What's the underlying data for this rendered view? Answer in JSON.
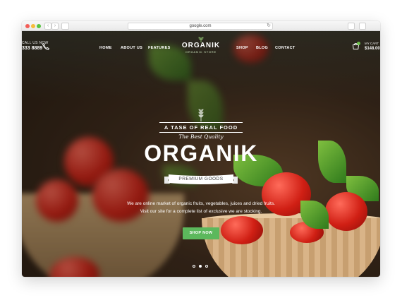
{
  "browser": {
    "url": "google.com",
    "back_glyph": "‹",
    "forward_glyph": "›",
    "reload_glyph": "↻"
  },
  "header": {
    "call_label": "CALL US NOW",
    "call_number": "333 8889",
    "nav_left": [
      "HOME",
      "ABOUT US",
      "FEATURES"
    ],
    "nav_right": [
      "SHOP",
      "BLOG",
      "CONTACT"
    ],
    "logo_title": "ORGANIK",
    "logo_subtitle": "ORGANIC STORE",
    "cart_label": "MY CART",
    "cart_total": "$148.00"
  },
  "hero": {
    "tagline": "A TASE OF REAL FOOD",
    "script": "The Best Quality",
    "title": "ORGANIK",
    "ribbon": "PREMIUM GOODS",
    "description_line1": "We are online market of organic fruits, vegetables, juices and dried fruits.",
    "description_line2": "Visit our site for a complete list of exclusive we are stocking.",
    "cta": "SHOP NOW"
  },
  "slider": {
    "active_index": 1,
    "count": 3
  },
  "colors": {
    "accent_green": "#5cb85c",
    "text_white": "#ffffff"
  },
  "icons": {
    "phone": "phone-icon",
    "cart": "shopping-cart-icon",
    "wheat": "wheat-icon",
    "sprout": "sprout-icon"
  }
}
